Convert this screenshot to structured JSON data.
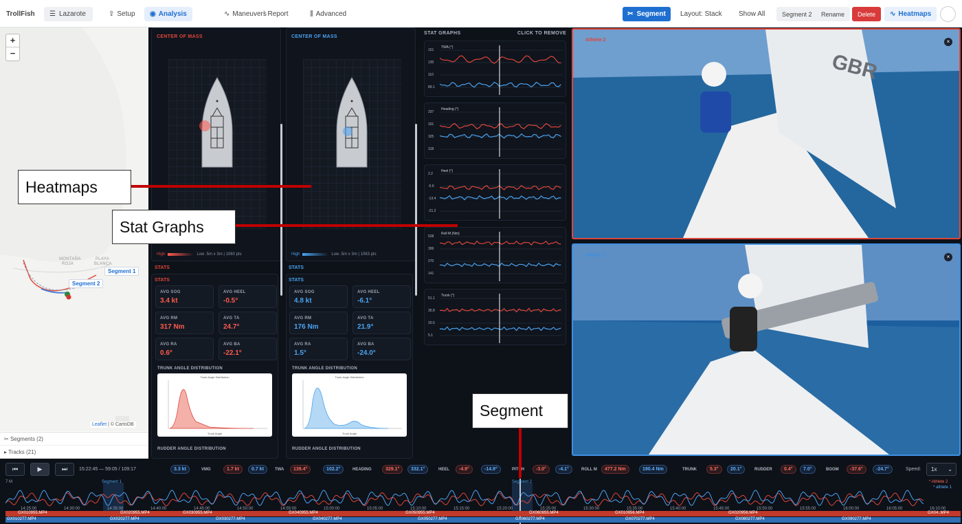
{
  "app": {
    "brand": "TrollFish",
    "location": "Lazarote"
  },
  "nav": {
    "tabs": [
      {
        "label": "Setup"
      },
      {
        "label": "Analysis"
      },
      {
        "label": "Maneuvers"
      },
      {
        "label": "Report"
      },
      {
        "label": "Advanced"
      }
    ],
    "segment_btn": "Segment",
    "layout": "Layout: Stack",
    "show_all": "Show All",
    "segment2": "Segment 2",
    "rename": "Rename",
    "delete": "Delete",
    "heatmaps": "Heatmaps"
  },
  "map": {
    "zoom_in": "+",
    "zoom_out": "−",
    "labels": [
      "MONTAÑA",
      "ROJA",
      "PLAYA",
      "BLANCA"
    ],
    "seg1": "Segment 1",
    "seg2": "Segment 2",
    "attribution_leaflet": "Leaflet",
    "attribution_rest": "| © CartoDB",
    "sidebar": [
      {
        "label": "Segments (2)"
      },
      {
        "label": "Tracks (21)"
      }
    ]
  },
  "center_of_mass": {
    "title": "CENTER OF MASS",
    "left": {
      "high": "High",
      "legend": "Low .5m x 3m | 1060 pts",
      "color": "#ff5a4e"
    },
    "right": {
      "high": "High",
      "legend": "Low .5m x 3m | 1063 pts",
      "color": "#4aa3f0"
    }
  },
  "stats": {
    "heading": "STATS",
    "left": [
      {
        "label": "AVG SOG",
        "value": "3.4 kt"
      },
      {
        "label": "AVG HEEL",
        "value": "-0.5°"
      },
      {
        "label": "AVG RM",
        "value": "317 Nm"
      },
      {
        "label": "AVG TA",
        "value": "24.7°"
      },
      {
        "label": "AVG RA",
        "value": "0.6°"
      },
      {
        "label": "AVG BA",
        "value": "-22.1°"
      }
    ],
    "right": [
      {
        "label": "AVG SOG",
        "value": "4.8 kt"
      },
      {
        "label": "AVG HEEL",
        "value": "-6.1°"
      },
      {
        "label": "AVG RM",
        "value": "176 Nm"
      },
      {
        "label": "AVG TA",
        "value": "21.9°"
      },
      {
        "label": "AVG RA",
        "value": "1.5°"
      },
      {
        "label": "AVG BA",
        "value": "-24.0°"
      }
    ],
    "trunk_dist": "TRUNK ANGLE DISTRIBUTION",
    "rudder_dist": "RUDDER ANGLE DISTRIBUTION",
    "dist_chart_title": "Trunk Angle Distribution",
    "dist_xlabel": "Trunk Angle"
  },
  "stat_graphs": {
    "title": "STAT GRAPHS",
    "remove": "CLICK TO REMOVE",
    "graphs": [
      {
        "label": "TWA (°)",
        "ticks": [
          "151",
          "130",
          "110",
          "89.1"
        ]
      },
      {
        "label": "Heading (°)",
        "ticks": [
          "337",
          "331",
          "325",
          "318"
        ]
      },
      {
        "label": "Heel (°)",
        "ticks": [
          "2.2",
          "-5.6",
          "-13.4",
          "-21.2"
        ]
      },
      {
        "label": "Roll M (Nm)",
        "ticks": [
          "528",
          "399",
          "270",
          "141"
        ]
      },
      {
        "label": "Trunk (°)",
        "ticks": [
          "51.1",
          "35.8",
          "20.5",
          "5.1"
        ]
      }
    ]
  },
  "videos": [
    {
      "label": "Athlete 2",
      "color": "#e0453a",
      "close": "×"
    },
    {
      "label": "athlete 1",
      "color": "#3f8fe0",
      "close": "×"
    }
  ],
  "callouts": {
    "heatmaps": "Heatmaps",
    "stat_graphs": "Stat Graphs",
    "segment": "Segment"
  },
  "timeline": {
    "time": "15:22:45 — 59:05 / 109:17",
    "speed_label": "Speed:",
    "speed": "1x",
    "metrics": [
      {
        "label": "VMG",
        "red": "1.7 kt",
        "blue": "0.7 kt"
      },
      {
        "label": "TWA",
        "red": "139.4°",
        "blue": "102.2°"
      },
      {
        "label": "HEADING",
        "red": "329.1°",
        "blue": "332.1°"
      },
      {
        "label": "HEEL",
        "red": "-4.9°",
        "blue": "-14.9°"
      },
      {
        "label": "PITCH",
        "red": "-3.0°",
        "blue": "-4.1°"
      },
      {
        "label": "ROLL M",
        "red": "477.2 Nm",
        "blue": "190.4 Nm"
      },
      {
        "label": "TRUNK",
        "red": "5.3°",
        "blue": "20.1°"
      },
      {
        "label": "RUDDER",
        "red": "0.4°",
        "blue": "7.0°"
      },
      {
        "label": "BOOM",
        "red": "-37.6°",
        "blue": "-24.7°"
      }
    ],
    "sog_blue": "3.3 kt",
    "axis_prefix": "7 M",
    "legend_a2": "* Athlete 2",
    "legend_a1": "* athlete 1",
    "seg1": "Segment 1",
    "seg2": "Segment 2",
    "times": [
      "14:25:00",
      "14:30:00",
      "14:35:00",
      "14:40:00",
      "14:45:00",
      "14:50:00",
      "14:55:00",
      "15:00:00",
      "15:05:00",
      "15:10:00",
      "15:15:00",
      "15:20:00",
      "15:25:00",
      "15:30:00",
      "15:35:00",
      "15:40:00",
      "15:45:00",
      "15:50:00",
      "15:55:00",
      "16:00:00",
      "16:05:00",
      "16:10:00"
    ],
    "files_red": [
      "GX010955.MP4",
      "GX020955.MP4",
      "GX030955.MP4",
      "GX040955.MP4",
      "GX050955.MP4",
      "GX060955.MP4",
      "GX010956.MP4",
      "GX020956.MP4",
      "GX04..MP4"
    ],
    "files_blue": [
      "GX010277.MP4",
      "GX020277.MP4",
      "GX030277.MP4",
      "GX040277.MP4",
      "GX050277.MP4",
      "GX060277.MP4",
      "GX070277.MP4",
      "GX080277.MP4",
      "GX090277.MP4"
    ]
  }
}
